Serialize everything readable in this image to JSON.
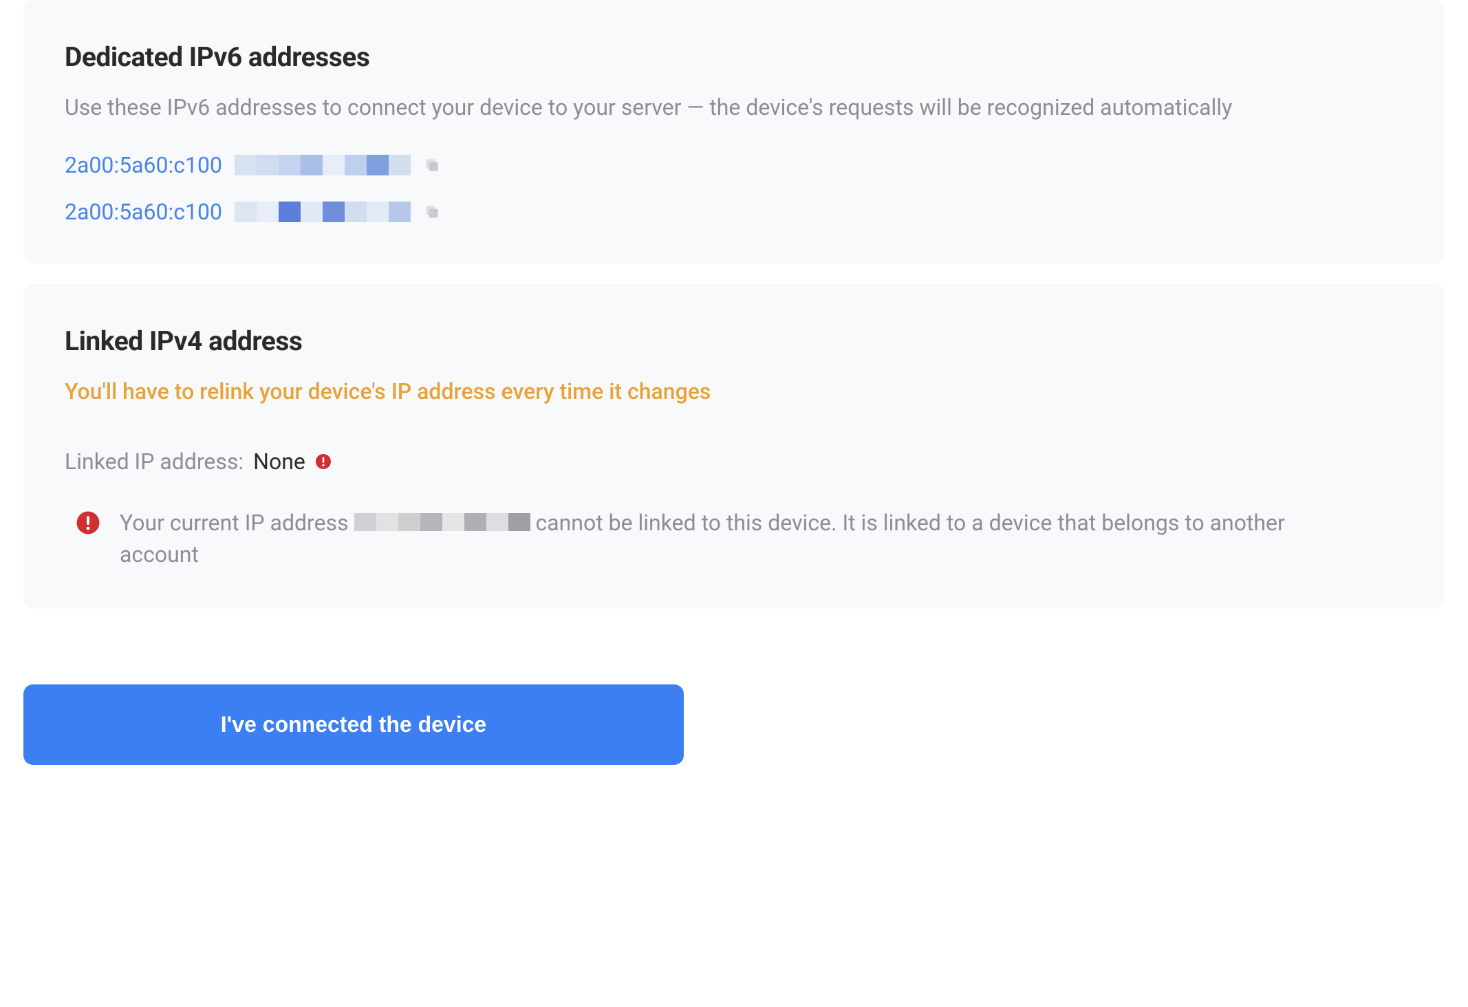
{
  "ipv6_card": {
    "title": "Dedicated IPv6 addresses",
    "description": "Use these IPv6 addresses to connect your device to your server — the device's requests will be recognized automatically",
    "addresses": [
      {
        "prefix": "2a00:5a60:c100"
      },
      {
        "prefix": "2a00:5a60:c100"
      }
    ]
  },
  "ipv4_card": {
    "title": "Linked IPv4 address",
    "warning": "You'll have to relink your device's IP address every time it changes",
    "linked_label": "Linked IP address: ",
    "linked_value": "None",
    "error_prefix": "Your current IP address ",
    "error_suffix": " cannot be linked to this device. It is linked to a device that belongs to another account"
  },
  "actions": {
    "connected_button": "I've connected the device"
  },
  "colors": {
    "accent": "#3c7ff2",
    "warning": "#e8a23a",
    "alert": "#cf2f2f",
    "muted": "#8d8d93",
    "card_bg": "#f8f9fb"
  }
}
